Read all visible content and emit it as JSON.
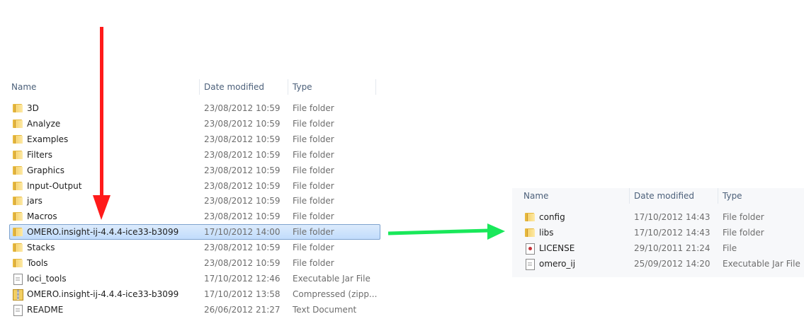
{
  "colors": {
    "arrow_down": "#ff1a1a",
    "arrow_right": "#19e85a",
    "selection": "#cce4fb"
  },
  "left": {
    "headers": {
      "name": "Name",
      "date": "Date modified",
      "type": "Type"
    },
    "rows": [
      {
        "name": "3D",
        "date": "23/08/2012 10:59",
        "type": "File folder",
        "icon": "folder-icon"
      },
      {
        "name": "Analyze",
        "date": "23/08/2012 10:59",
        "type": "File folder",
        "icon": "folder-icon"
      },
      {
        "name": "Examples",
        "date": "23/08/2012 10:59",
        "type": "File folder",
        "icon": "folder-icon"
      },
      {
        "name": "Filters",
        "date": "23/08/2012 10:59",
        "type": "File folder",
        "icon": "folder-icon"
      },
      {
        "name": "Graphics",
        "date": "23/08/2012 10:59",
        "type": "File folder",
        "icon": "folder-icon"
      },
      {
        "name": "Input-Output",
        "date": "23/08/2012 10:59",
        "type": "File folder",
        "icon": "folder-icon"
      },
      {
        "name": "jars",
        "date": "23/08/2012 10:59",
        "type": "File folder",
        "icon": "folder-icon"
      },
      {
        "name": "Macros",
        "date": "23/08/2012 10:59",
        "type": "File folder",
        "icon": "folder-icon"
      },
      {
        "name": "OMERO.insight-ij-4.4.4-ice33-b3099",
        "date": "17/10/2012 14:00",
        "type": "File folder",
        "icon": "folder-icon",
        "selected": true
      },
      {
        "name": "Stacks",
        "date": "23/08/2012 10:59",
        "type": "File folder",
        "icon": "folder-icon"
      },
      {
        "name": "Tools",
        "date": "23/08/2012 10:59",
        "type": "File folder",
        "icon": "folder-icon"
      },
      {
        "name": "loci_tools",
        "date": "17/10/2012 12:46",
        "type": "Executable Jar File",
        "icon": "jar-file-icon"
      },
      {
        "name": "OMERO.insight-ij-4.4.4-ice33-b3099",
        "date": "17/10/2012 13:58",
        "type": "Compressed (zipp...",
        "icon": "zip-file-icon"
      },
      {
        "name": "README",
        "date": "26/06/2012 21:27",
        "type": "Text Document",
        "icon": "text-file-icon"
      }
    ]
  },
  "right": {
    "headers": {
      "name": "Name",
      "date": "Date modified",
      "type": "Type"
    },
    "rows": [
      {
        "name": "config",
        "date": "17/10/2012 14:43",
        "type": "File folder",
        "icon": "folder-icon"
      },
      {
        "name": "libs",
        "date": "17/10/2012 14:43",
        "type": "File folder",
        "icon": "folder-icon"
      },
      {
        "name": "LICENSE",
        "date": "29/10/2011 21:24",
        "type": "File",
        "icon": "license-file-icon"
      },
      {
        "name": "omero_ij",
        "date": "25/09/2012 14:20",
        "type": "Executable Jar File",
        "icon": "jar-file-icon"
      }
    ]
  }
}
